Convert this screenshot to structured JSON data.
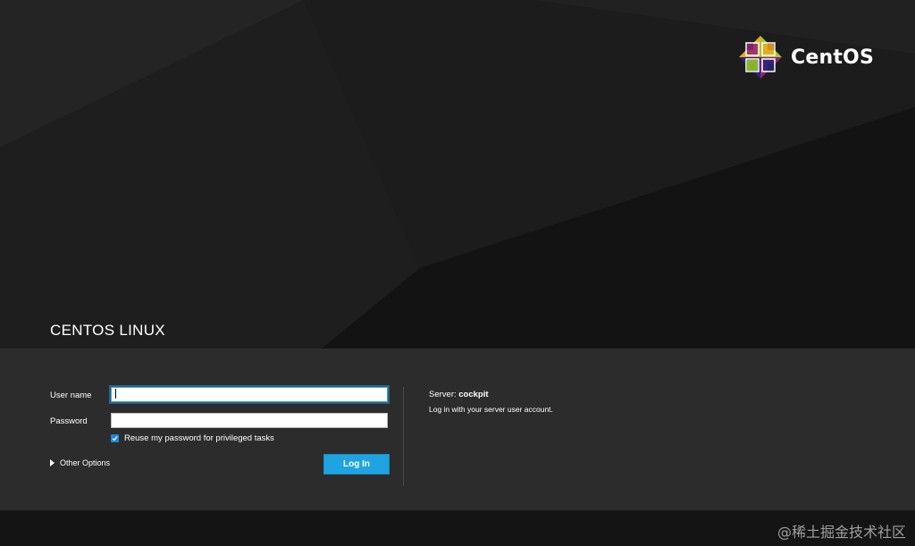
{
  "brand": {
    "name": "CentOS",
    "logo_icon": "centos-logo-icon",
    "colors": [
      "#9ccd2a",
      "#932279",
      "#efa724",
      "#262577"
    ]
  },
  "os_title": "CENTOS LINUX",
  "form": {
    "username_label": "User name",
    "username_value": "",
    "password_label": "Password",
    "password_value": "",
    "reuse_password_label": "Reuse my password for privileged tasks",
    "reuse_password_checked": true,
    "other_options_label": "Other Options",
    "login_button_label": "Log In"
  },
  "info": {
    "server_prefix": "Server:",
    "server_name": "cockpit",
    "hint": "Log in with your server user account."
  },
  "watermark": "@稀土掘金技术社区",
  "colors": {
    "accent": "#1ea4e0",
    "focus": "#39a5dc",
    "background": "#161616",
    "band": "#2e2e2e"
  }
}
